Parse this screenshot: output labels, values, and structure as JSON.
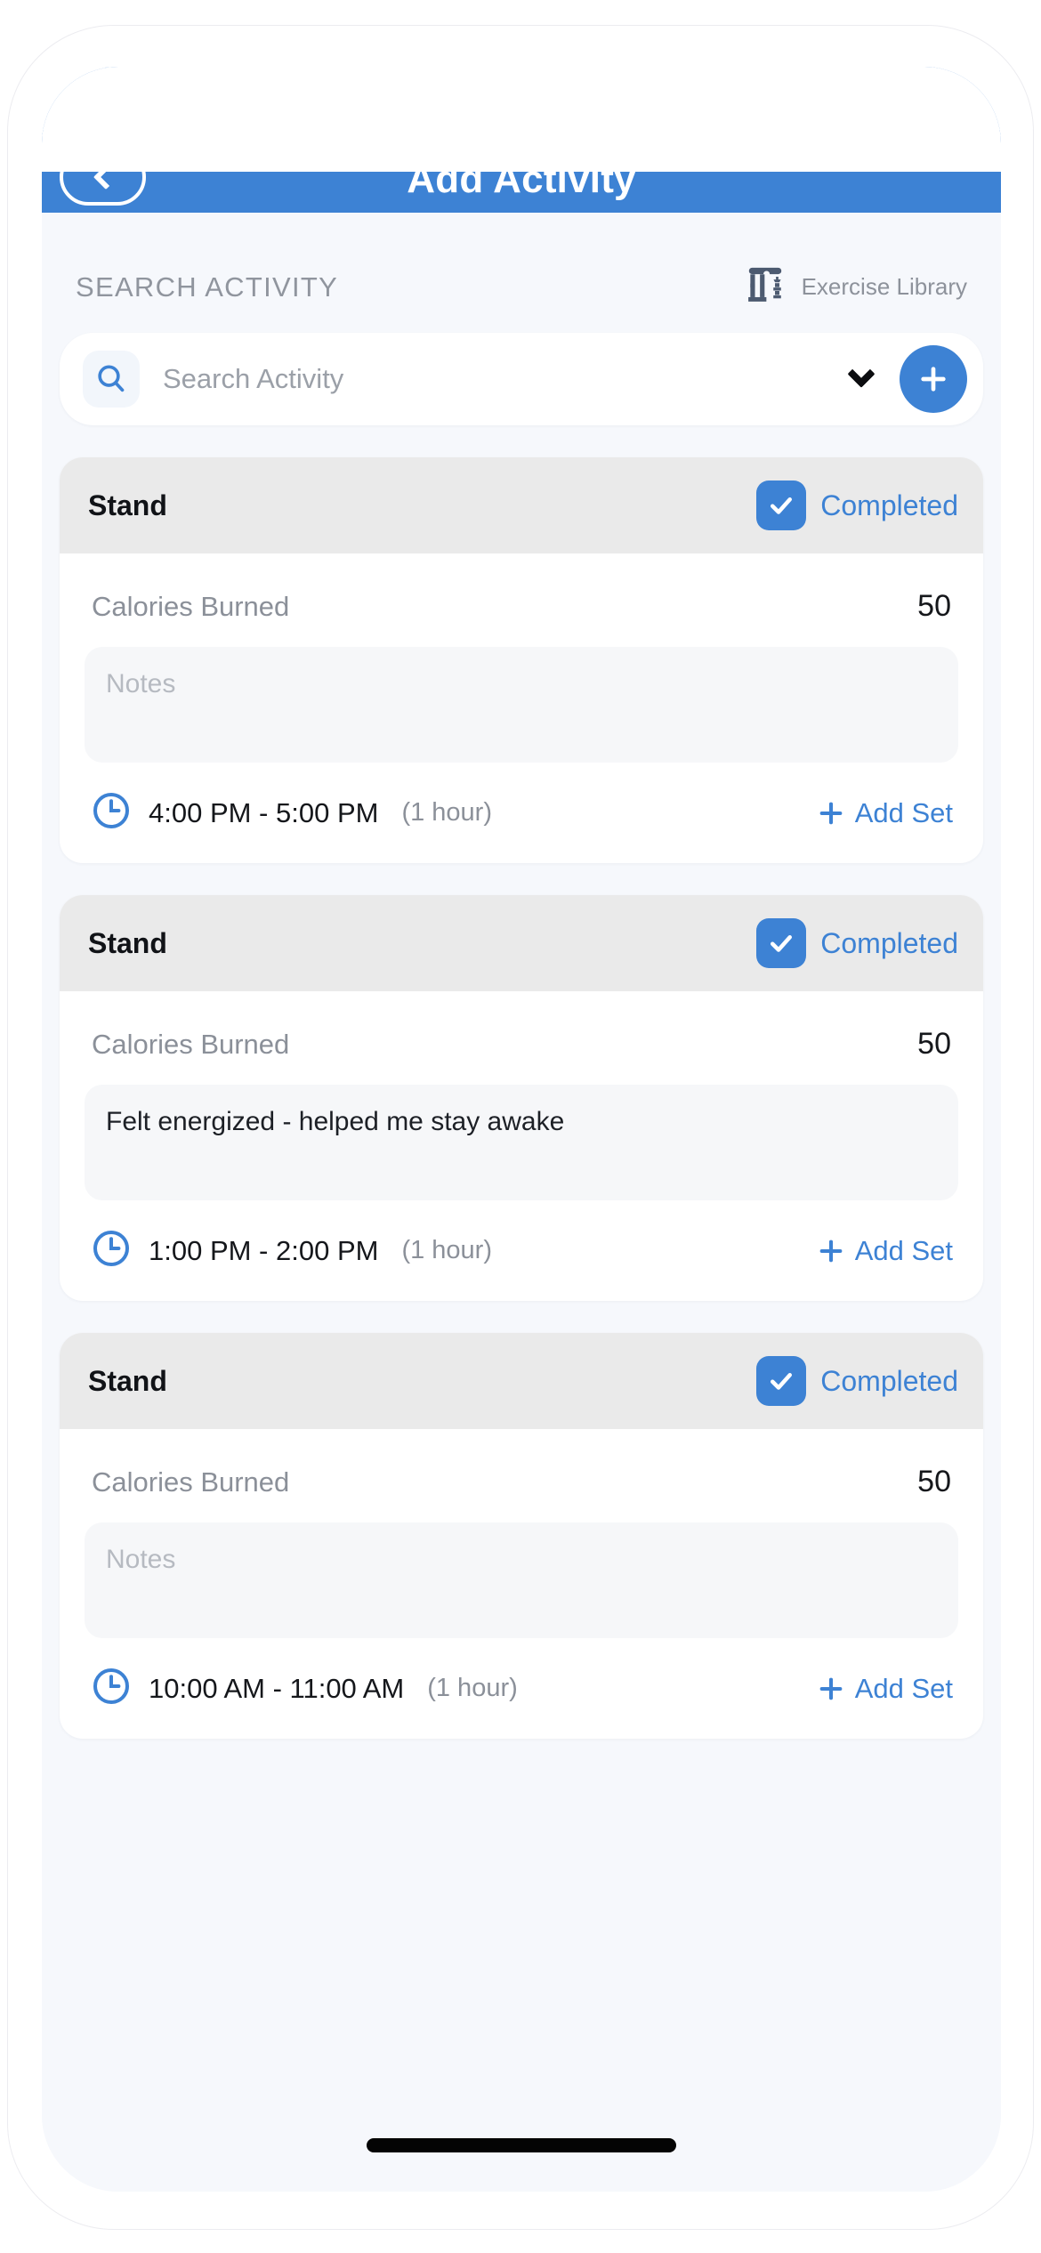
{
  "header": {
    "title": "Add Activity",
    "back_icon": "chevron-left-icon",
    "accent_color": "#3d82d4"
  },
  "search_section": {
    "label": "SEARCH ACTIVITY",
    "library_label": "Exercise Library",
    "library_icon": "column-library-icon",
    "search_icon": "search-icon",
    "placeholder": "Search Activity",
    "value": "",
    "dropdown_icon": "chevron-down-icon",
    "add_icon": "plus-icon"
  },
  "activities": [
    {
      "title": "Stand",
      "completed_label": "Completed",
      "completed": true,
      "check_icon": "check-icon",
      "metric_label": "Calories Burned",
      "metric_value": "50",
      "notes": "",
      "notes_placeholder": "Notes",
      "clock_icon": "clock-icon",
      "time_range": "4:00 PM - 5:00 PM",
      "duration": "(1 hour)",
      "add_set_label": "Add Set",
      "add_set_icon": "plus-icon"
    },
    {
      "title": "Stand",
      "completed_label": "Completed",
      "completed": true,
      "check_icon": "check-icon",
      "metric_label": "Calories Burned",
      "metric_value": "50",
      "notes": "Felt energized - helped me stay awake",
      "notes_placeholder": "Notes",
      "clock_icon": "clock-icon",
      "time_range": "1:00 PM - 2:00 PM",
      "duration": "(1 hour)",
      "add_set_label": "Add Set",
      "add_set_icon": "plus-icon"
    },
    {
      "title": "Stand",
      "completed_label": "Completed",
      "completed": true,
      "check_icon": "check-icon",
      "metric_label": "Calories Burned",
      "metric_value": "50",
      "notes": "",
      "notes_placeholder": "Notes",
      "clock_icon": "clock-icon",
      "time_range": "10:00 AM - 11:00 AM",
      "duration": "(1 hour)",
      "add_set_label": "Add Set",
      "add_set_icon": "plus-icon"
    }
  ]
}
